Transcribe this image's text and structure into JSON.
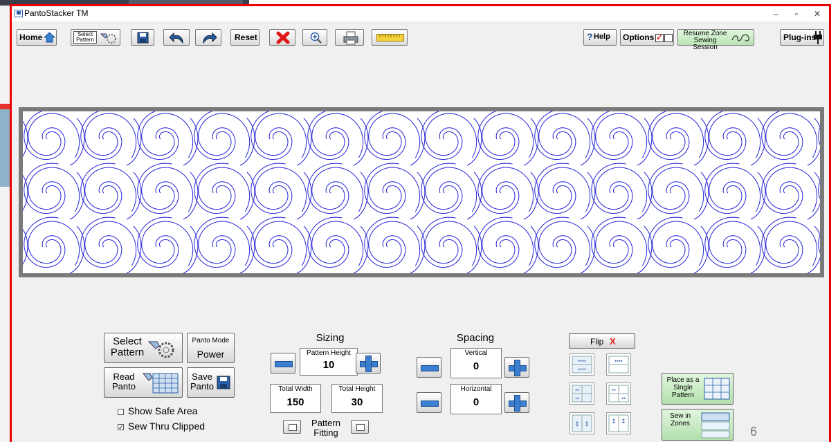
{
  "window": {
    "title": "PantoStacker TM",
    "minimize": "–",
    "restore": "▫",
    "close": "✕"
  },
  "toolbar": {
    "home": "Home",
    "select_pattern": "Select Pattern",
    "reset": "Reset",
    "help": "Help",
    "options": "Options",
    "resume_zone": "Resume Zone Sewing Session",
    "plugins": "Plug-ins"
  },
  "controls": {
    "select_pattern": "Select Pattern",
    "panto_mode_label": "Panto Mode",
    "panto_mode_value": "Power",
    "read_panto": "Read Panto",
    "save_panto": "Save Panto",
    "show_safe_area": "Show Safe Area",
    "show_safe_area_checked": false,
    "sew_thru_clipped": "Sew Thru Clipped",
    "sew_thru_clipped_checked": true
  },
  "sizing": {
    "title": "Sizing",
    "pattern_height_label": "Pattern Height",
    "pattern_height": "10",
    "total_width_label": "Total Width",
    "total_width": "150",
    "total_height_label": "Total Height",
    "total_height": "30",
    "pattern_fitting": "Pattern Fitting"
  },
  "spacing": {
    "title": "Spacing",
    "vertical_label": "Vertical",
    "vertical": "0",
    "horizontal_label": "Horizontal",
    "horizontal": "0"
  },
  "flip": {
    "label": "Flip",
    "x": "X"
  },
  "place": {
    "single": "Place as a Single Pattern",
    "zones": "Sew in Zones"
  },
  "slide_number": "6",
  "colors": {
    "frame_red": "#ee0000",
    "pattern_blue": "#2323d6",
    "accent_blue": "#3b7fd0",
    "resume_green": "#c9ecc5"
  }
}
